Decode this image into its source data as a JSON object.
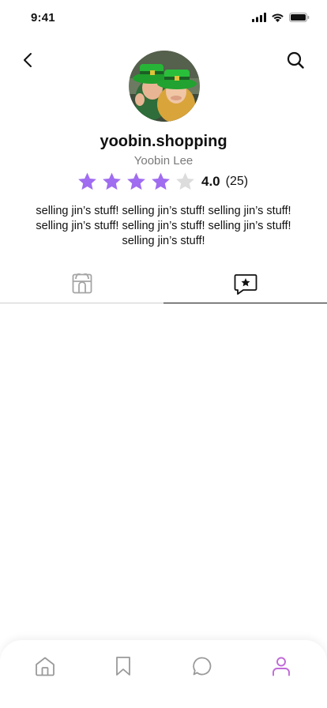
{
  "status_bar": {
    "time": "9:41"
  },
  "profile": {
    "username": "yoobin.shopping",
    "name": "Yoobin Lee",
    "rating_value": "4.0",
    "rating_count": "(25)",
    "rating_stars": 4,
    "rating_max": 5,
    "bio": "selling jin’s stuff! selling jin’s stuff! selling jin’s stuff! selling jin’s stuff! selling jin’s stuff! selling jin’s stuff! selling jin’s stuff!"
  },
  "tabs": [
    {
      "icon": "shop-icon",
      "active": false
    },
    {
      "icon": "review-star-icon",
      "active": true
    }
  ],
  "nav": [
    {
      "icon": "home-icon",
      "active": false
    },
    {
      "icon": "bookmark-icon",
      "active": false
    },
    {
      "icon": "chat-icon",
      "active": false
    },
    {
      "icon": "profile-icon",
      "active": true
    }
  ],
  "colors": {
    "star_filled": "#a06cf0",
    "star_empty": "#dcdcdc",
    "nav_active": "#c06ad8",
    "nav_inactive": "#9a9a9a",
    "muted_text": "#7a7a7a"
  }
}
